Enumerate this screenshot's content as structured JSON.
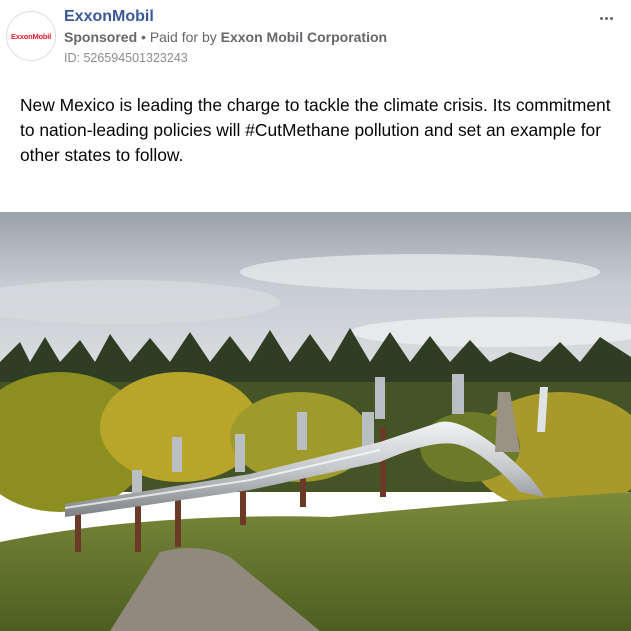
{
  "post": {
    "page_name": "ExxonMobil",
    "avatar_logo_text": "ExxonMobil",
    "sponsored_label": "Sponsored",
    "separator": "•",
    "paid_for_prefix": "Paid for by",
    "paid_for_by": "Exxon Mobil Corporation",
    "ad_id": "ID: 526594501323243",
    "caption": "New Mexico is leading the charge to tackle the climate crisis. Its commitment to nation-leading policies will #CutMethane pollution and set an example for other states to follow.",
    "more_icon": "more-horizontal-icon"
  },
  "colors": {
    "page_name": "#385898",
    "meta_text": "#65676b",
    "brand_red": "#e3182d"
  }
}
